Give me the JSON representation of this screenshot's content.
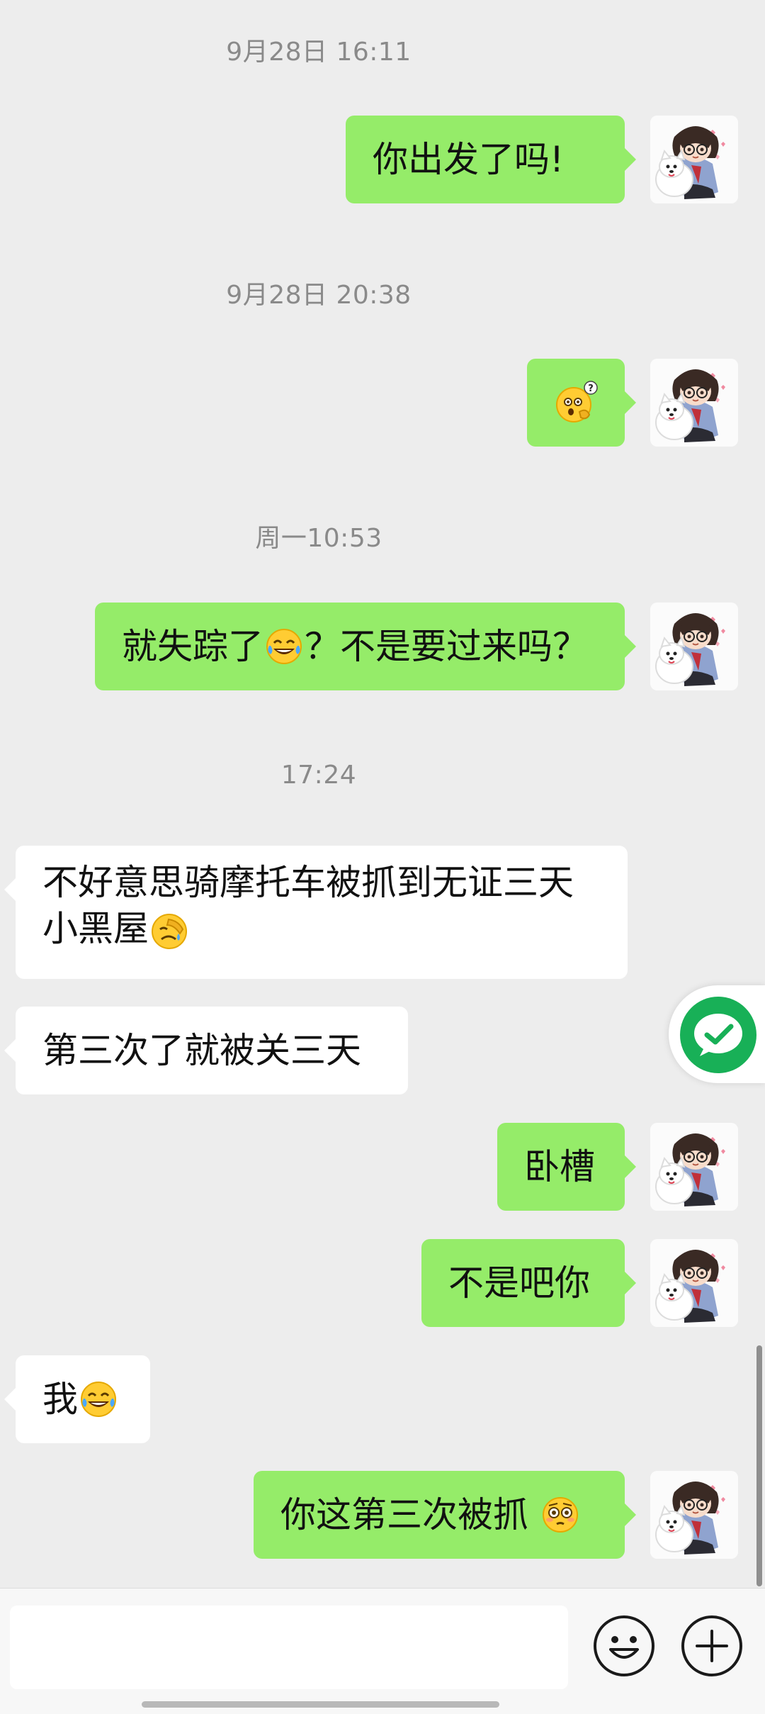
{
  "timestamps": [
    "9月28日 16:11",
    "9月28日 20:38",
    "周一10:53",
    "17:24"
  ],
  "messages": [
    {
      "dir": "out",
      "text": "你出发了吗!"
    },
    {
      "dir": "out",
      "sticker": "surprised-question-emoji"
    },
    {
      "dir": "out",
      "text_a": "就失踪了",
      "emoji_a": "tears-of-joy-emoji",
      "text_b": "？不是要过来吗？"
    },
    {
      "dir": "in",
      "line1": "不好意思骑摩托车被抓到无证三天",
      "line2": "小黑屋",
      "emoji": "facepalm-emoji"
    },
    {
      "dir": "in",
      "text": "第三次了就被关三天"
    },
    {
      "dir": "out",
      "text": "卧槽"
    },
    {
      "dir": "out",
      "text": "不是吧你"
    },
    {
      "dir": "in",
      "text": "我",
      "emoji": "tears-of-joy-emoji"
    },
    {
      "dir": "out",
      "text": "你这第三次被抓 ",
      "emoji": "flushed-emoji"
    }
  ],
  "avatar": {
    "description_icon": "user-avatar-boy-with-dog"
  },
  "colors": {
    "outgoing": "#95ec69",
    "incoming": "#ffffff",
    "background": "#ededed",
    "accent": "#18b057"
  },
  "input": {
    "placeholder": ""
  },
  "bottom_icons": [
    "smiley-icon",
    "plus-icon"
  ],
  "floating_button_icon": "wechat-icon"
}
